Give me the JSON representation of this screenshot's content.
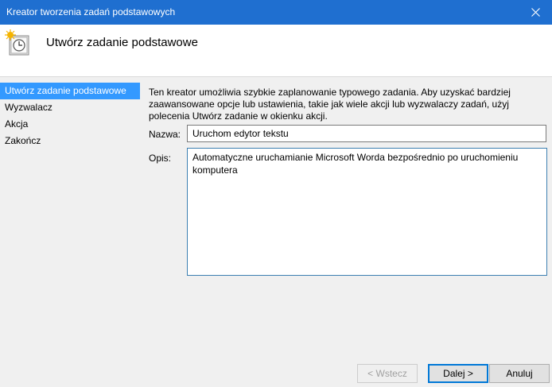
{
  "window": {
    "title": "Kreator tworzenia zadań podstawowych",
    "close_icon": "close-icon"
  },
  "header": {
    "icon": "task-scheduler-icon",
    "title": "Utwórz zadanie podstawowe"
  },
  "sidebar": {
    "items": [
      {
        "label": "Utwórz zadanie podstawowe",
        "active": true
      },
      {
        "label": "Wyzwalacz",
        "active": false
      },
      {
        "label": "Akcja",
        "active": false
      },
      {
        "label": "Zakończ",
        "active": false
      }
    ]
  },
  "main": {
    "description": "Ten kreator umożliwia szybkie zaplanowanie typowego zadania. Aby uzyskać bardziej zaawansowane opcje lub ustawienia, takie jak wiele akcji lub wyzwalaczy zadań, użyj polecenia Utwórz zadanie w okienku akcji.",
    "name_label": "Nazwa:",
    "name_value": "Uruchom edytor tekstu",
    "desc_label": "Opis:",
    "desc_value": "Automatyczne uruchamianie Microsoft Worda bezpośrednio po uruchomieniu komputera"
  },
  "buttons": {
    "back": "< Wstecz",
    "next": "Dalej >",
    "cancel": "Anuluj"
  },
  "colors": {
    "titlebar": "#1f6fd0",
    "selection": "#3399ff",
    "focus_border": "#0078d7"
  }
}
